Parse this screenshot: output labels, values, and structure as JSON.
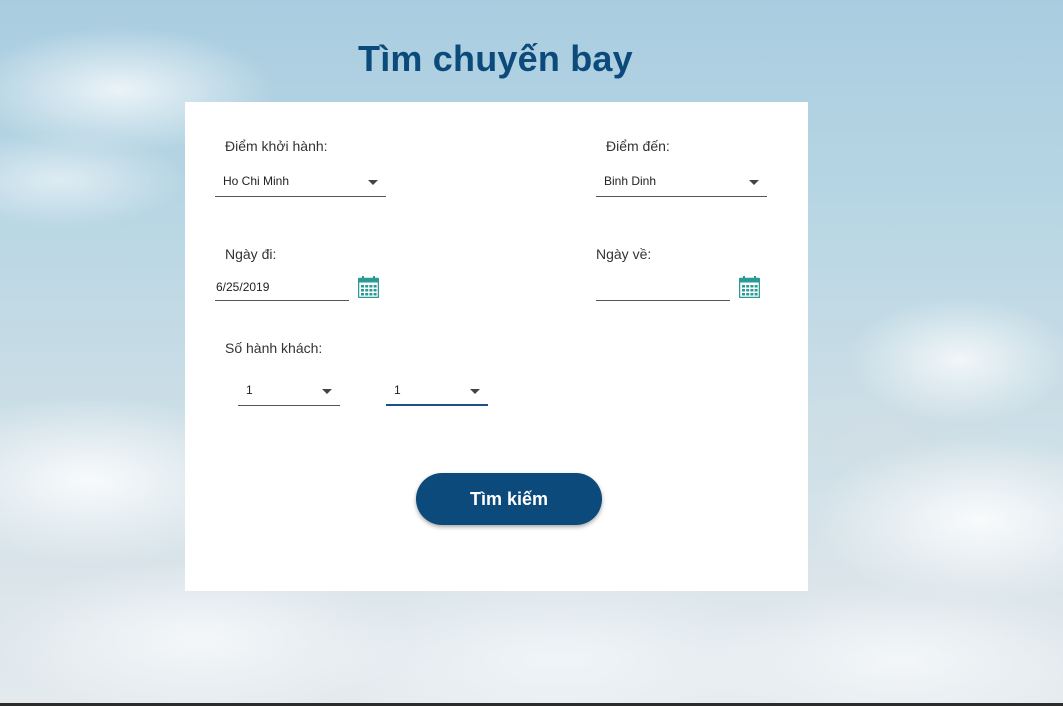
{
  "page": {
    "title": "Tìm chuyến bay"
  },
  "form": {
    "origin": {
      "label": "Điểm khởi hành:",
      "value": "Ho Chi Minh"
    },
    "destination": {
      "label": "Điểm đến:",
      "value": "Binh Dinh"
    },
    "depart_date": {
      "label": "Ngày đi:",
      "value": "6/25/2019"
    },
    "return_date": {
      "label": "Ngày về:",
      "value": ""
    },
    "passengers": {
      "label": "Số hành khách:",
      "select_1_value": "1",
      "select_2_value": "1"
    },
    "search_button_label": "Tìm kiếm"
  },
  "icons": {
    "calendar": "calendar-icon",
    "dropdown": "chevron-down-icon"
  },
  "colors": {
    "brand": "#0b4a7a",
    "calendar_icon": "#2a9a96",
    "focus_underline": "#1f4f88"
  }
}
